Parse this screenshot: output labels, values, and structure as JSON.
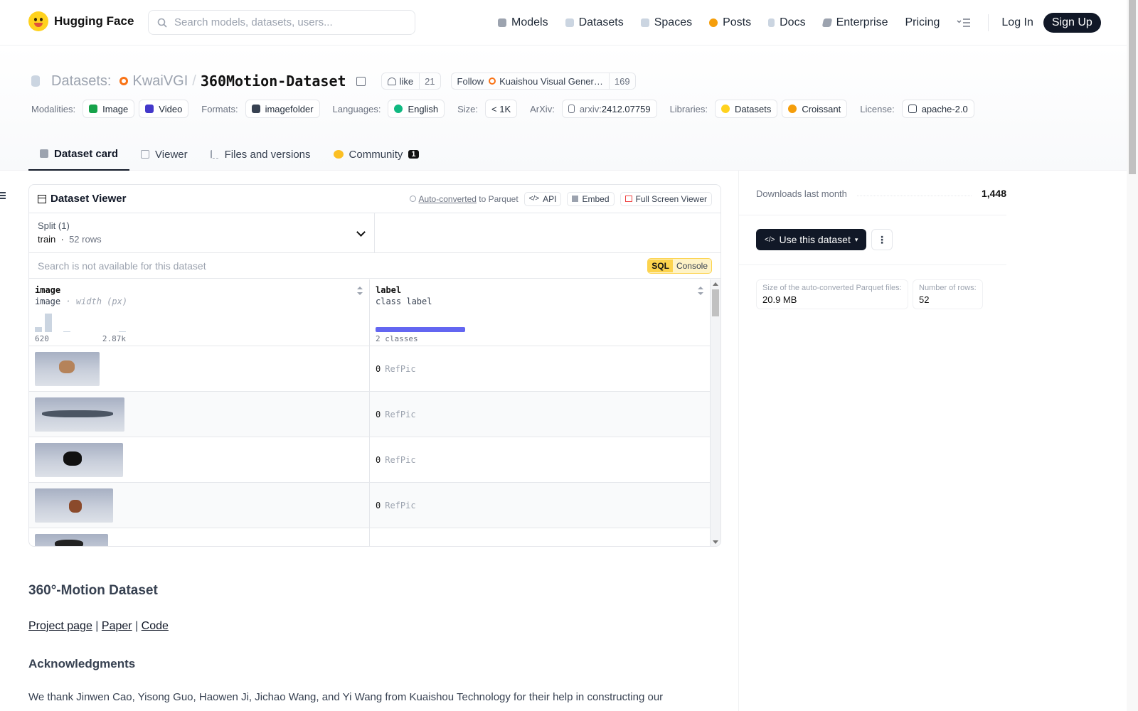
{
  "brand": {
    "name": "Hugging Face"
  },
  "search": {
    "placeholder": "Search models, datasets, users..."
  },
  "nav": {
    "items": [
      {
        "label": "Models",
        "icon": "cube-icon",
        "color": "#9ca3af"
      },
      {
        "label": "Datasets",
        "icon": "database-icon",
        "color": "#cbd5e1"
      },
      {
        "label": "Spaces",
        "icon": "grid-icon",
        "color": "#cbd5e1"
      },
      {
        "label": "Posts",
        "icon": "chat-icon",
        "color": "#f59e0b"
      },
      {
        "label": "Docs",
        "icon": "doc-icon",
        "color": "#cbd5e1"
      },
      {
        "label": "Enterprise",
        "icon": "enterprise-icon",
        "color": "#9ca3af"
      }
    ],
    "pricing": "Pricing",
    "login": "Log In",
    "signup": "Sign Up"
  },
  "header": {
    "section": "Datasets:",
    "org": "KwaiVGI",
    "slash": "/",
    "name": "360Motion-Dataset",
    "like_label": "like",
    "like_count": "21",
    "follow_label": "Follow",
    "follow_org": "Kuaishou Visual Gener…",
    "follow_count": "169"
  },
  "tags": {
    "modalities_label": "Modalities:",
    "modalities": [
      "Image",
      "Video"
    ],
    "formats_label": "Formats:",
    "formats": [
      "imagefolder"
    ],
    "languages_label": "Languages:",
    "languages": [
      "English"
    ],
    "size_label": "Size:",
    "size": "< 1K",
    "arxiv_label": "ArXiv:",
    "arxiv_prefix": "arxiv:",
    "arxiv_id": "2412.07759",
    "libraries_label": "Libraries:",
    "libraries": [
      "Datasets",
      "Croissant"
    ],
    "license_label": "License:",
    "license": "apache-2.0"
  },
  "tabs": [
    {
      "label": "Dataset card",
      "active": true
    },
    {
      "label": "Viewer"
    },
    {
      "label": "Files and versions"
    },
    {
      "label": "Community",
      "badge": "1"
    }
  ],
  "viewer": {
    "title": "Dataset Viewer",
    "auto_converted": "Auto-converted",
    "to_parquet": "to Parquet",
    "api": "API",
    "embed": "Embed",
    "fullscreen": "Full Screen Viewer",
    "split_label": "Split (1)",
    "split_name": "train",
    "split_rows": "52 rows",
    "search_note": "Search is not available for this dataset",
    "sql": "SQL",
    "console": "Console",
    "columns": [
      {
        "name": "image",
        "type": "image",
        "subtype": "width (px)",
        "min": "620",
        "max": "2.87k"
      },
      {
        "name": "label",
        "type": "class label",
        "summary": "2 classes"
      }
    ],
    "rows": [
      {
        "label_id": "0",
        "label_name": "RefPic"
      },
      {
        "label_id": "0",
        "label_name": "RefPic"
      },
      {
        "label_id": "0",
        "label_name": "RefPic"
      },
      {
        "label_id": "0",
        "label_name": "RefPic"
      }
    ]
  },
  "card": {
    "title": "360°-Motion Dataset",
    "links": [
      "Project page",
      "Paper",
      "Code"
    ],
    "link_sep": "|",
    "ack_title": "Acknowledgments",
    "ack_text": "We thank Jinwen Cao, Yisong Guo, Haowen Ji, Jichao Wang, and Yi Wang from Kuaishou Technology for their help in constructing our"
  },
  "sidebar": {
    "downloads_label": "Downloads last month",
    "downloads_value": "1,448",
    "use_button": "Use this dataset",
    "parquet_size_label": "Size of the auto-converted Parquet files:",
    "parquet_size": "20.9 MB",
    "rows_label": "Number of rows:",
    "rows": "52"
  }
}
